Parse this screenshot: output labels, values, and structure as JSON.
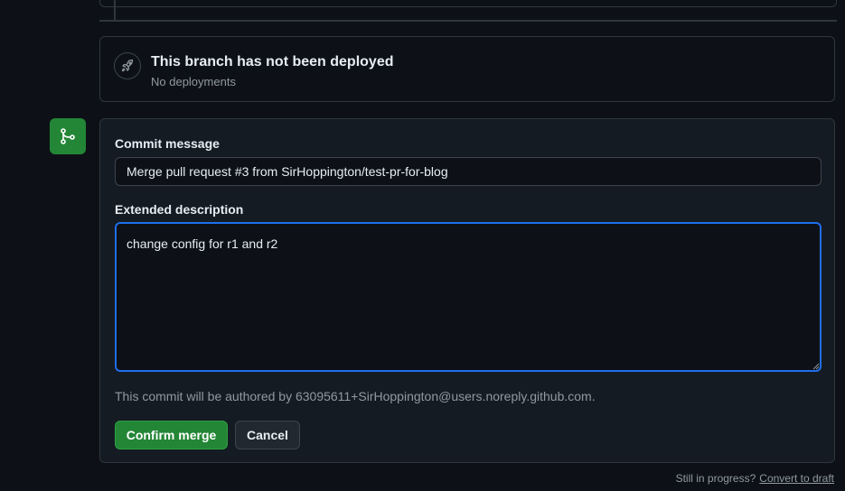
{
  "deployment": {
    "title": "This branch has not been deployed",
    "subtitle": "No deployments",
    "icon": "rocket-icon"
  },
  "merge_form": {
    "icon": "git-merge-icon",
    "commit_message_label": "Commit message",
    "commit_message_value": "Merge pull request #3 from SirHoppington/test-pr-for-blog",
    "extended_description_label": "Extended description",
    "extended_description_value": "change config for r1 and r2",
    "author_note": "This commit will be authored by 63095611+SirHoppington@users.noreply.github.com.",
    "confirm_label": "Confirm merge",
    "cancel_label": "Cancel"
  },
  "footer": {
    "prompt": "Still in progress?",
    "link": "Convert to draft"
  },
  "colors": {
    "background": "#0d1117",
    "panel": "#151b23",
    "border": "#30363d",
    "accent_green": "#238636",
    "focus_blue": "#1f6feb",
    "muted_text": "#9198a1"
  }
}
